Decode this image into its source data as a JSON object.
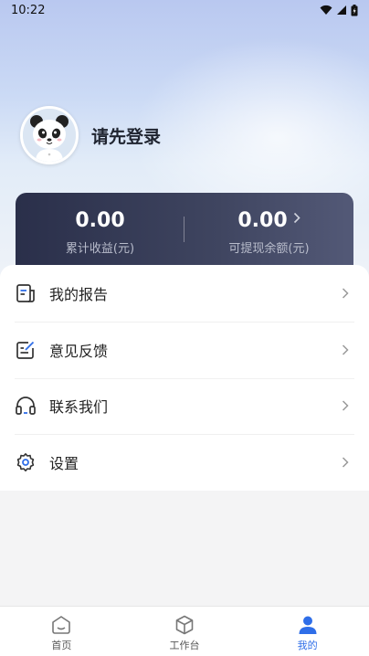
{
  "status_bar": {
    "time": "10:22"
  },
  "profile": {
    "login_prompt": "请先登录",
    "avatar_icon": "panda-avatar-icon"
  },
  "stats": {
    "cumulative_income": {
      "value": "0.00",
      "label": "累计收益(元)"
    },
    "withdrawable_balance": {
      "value": "0.00",
      "label": "可提现余额(元)"
    }
  },
  "menu": {
    "items": [
      {
        "label": "我的报告",
        "icon": "report-icon"
      },
      {
        "label": "意见反馈",
        "icon": "feedback-icon"
      },
      {
        "label": "联系我们",
        "icon": "headset-icon"
      },
      {
        "label": "设置",
        "icon": "settings-icon"
      }
    ]
  },
  "tabbar": {
    "tabs": [
      {
        "label": "首页",
        "icon": "home-icon",
        "active": false
      },
      {
        "label": "工作台",
        "icon": "cube-icon",
        "active": false
      },
      {
        "label": "我的",
        "icon": "user-icon",
        "active": true
      }
    ]
  },
  "colors": {
    "accent": "#2f6ee8",
    "card_dark": "#2a2f4a"
  }
}
